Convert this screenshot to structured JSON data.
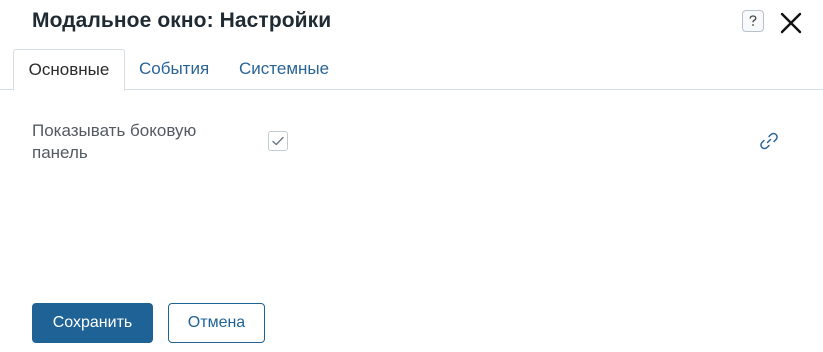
{
  "modal": {
    "title": "Модальное окно: Настройки",
    "help_icon": "question-icon",
    "close_icon": "close-icon"
  },
  "tabs": [
    {
      "label": "Основные",
      "active": true
    },
    {
      "label": "События",
      "active": false
    },
    {
      "label": "Системные",
      "active": false
    }
  ],
  "fields": [
    {
      "label": "Показывать боковую панель",
      "checked": true,
      "icon": "link-icon"
    }
  ],
  "footer": {
    "save_label": "Сохранить",
    "cancel_label": "Отмена"
  },
  "colors": {
    "primary": "#1f6396",
    "tab_link": "#2a6496",
    "border": "#d6dde3"
  }
}
